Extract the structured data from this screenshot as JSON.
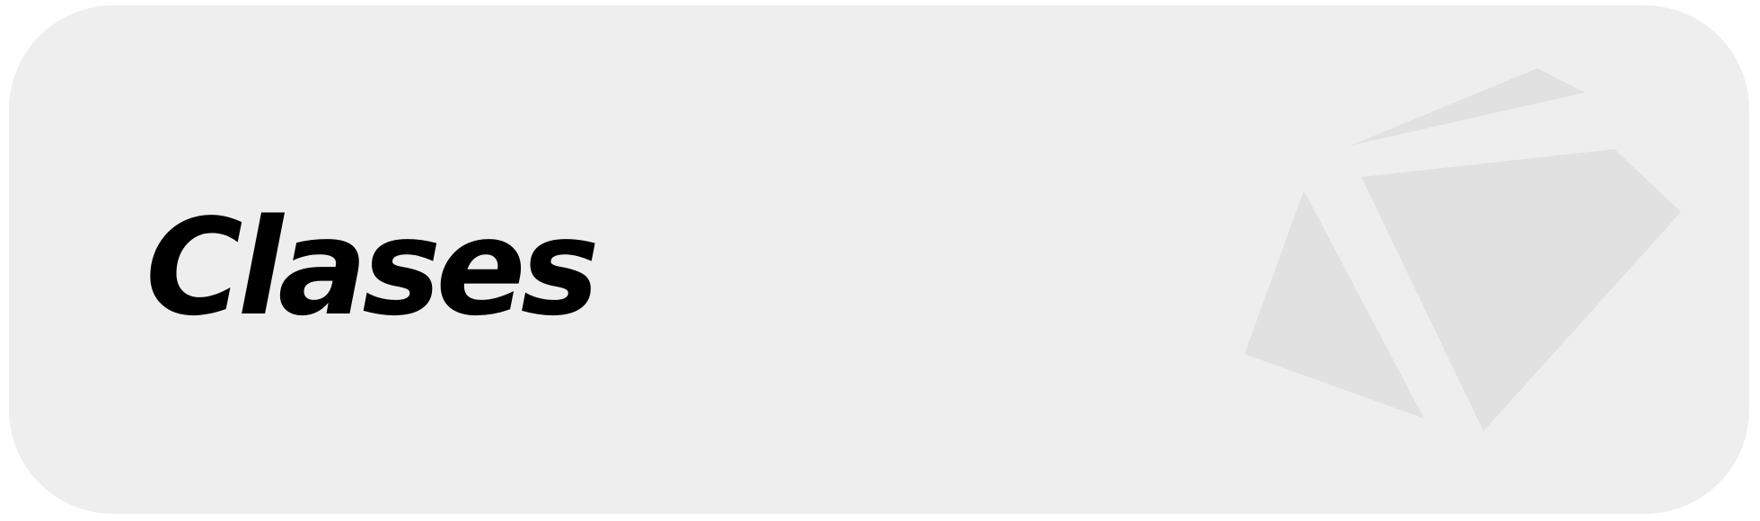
{
  "card": {
    "title": "Clases",
    "icon": "crystal-shards-icon",
    "background_color": "#eeeeee",
    "shard_color": "#e1e1e1",
    "text_color": "#000000"
  }
}
